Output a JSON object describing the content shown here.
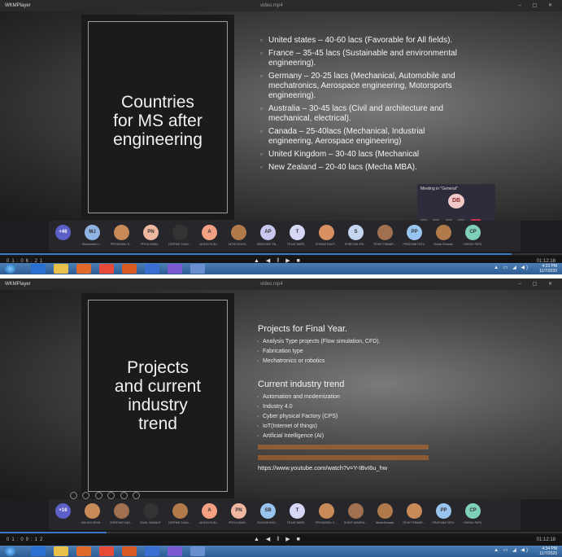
{
  "window": {
    "app_name": "WKMPlayer",
    "file_name": "video.mp4",
    "controls": "– ▢ ✕"
  },
  "slide1": {
    "title_lines": [
      "Countries",
      "for MS after",
      "engineering"
    ],
    "bullets": [
      "United states – 40-60 lacs (Favorable for All fields).",
      "France – 35-45 lacs (Sustainable and environmental engineering).",
      "Germany – 20-25 lacs (Mechanical, Automobile and mechatronics, Aerospace engineering, Motorsports engineering).",
      "Australia – 30-45 lacs (Civil and architecture and mechanical, electrical).",
      "Canada – 25-40lacs (Mechanical, Industrial engineering, Aerospace engineering)",
      "United Kingdom – 30-40 lacs (Mechanical",
      "New Zealand – 20-40 lacs (Mecha MBA)."
    ],
    "meeting_popup": {
      "title": "Meeting in \"General\"",
      "initials": "DB"
    }
  },
  "slide2": {
    "title_lines": [
      "Projects",
      "and current",
      "industry",
      "trend"
    ],
    "section1_heading": "Projects for Final Year.",
    "section1_items": [
      "Analysis Type projects (Flow simulation, CFD).",
      "Fabrication type",
      "Mechatronics or robotics"
    ],
    "section2_heading": "Current industry trend",
    "section2_items": [
      "Automation and modernization",
      "Industry 4.0",
      "Cyber physical Factory (CPS)",
      "IoT(Internet of things)",
      "Artificial Intelligence (AI)"
    ],
    "link_url": "https://www.youtube.com/watch?v=Y-IBvI6u_hw"
  },
  "participants1": [
    {
      "initials": "+46",
      "color": "#5b5fc7",
      "name": ""
    },
    {
      "initials": "MJ",
      "color": "#8fb4e3",
      "name": "Mohammed J..."
    },
    {
      "initials": "",
      "color": "#c98a5a",
      "name": "PRIYANSHU S..."
    },
    {
      "initials": "PN",
      "color": "#f0b8a0",
      "name": "PRIYA NAND..."
    },
    {
      "initials": "",
      "color": "#333",
      "name": "DEEPAK CHAU..."
    },
    {
      "initials": "A",
      "color": "#f4a082",
      "name": "AKASH KUM..."
    },
    {
      "initials": "",
      "color": "#b07a4a",
      "name": "NITIN SINGH..."
    },
    {
      "initials": "AP",
      "color": "#c7c7f0",
      "name": "ABHISHEK PA..."
    },
    {
      "initials": "T",
      "color": "#d6d6f5",
      "name": "TEJAS BARE..."
    },
    {
      "initials": "",
      "color": "#d99060",
      "name": "SHIVAM RAUT..."
    },
    {
      "initials": "S",
      "color": "#c6d6f0",
      "name": "SHREYAS SHI..."
    },
    {
      "initials": "",
      "color": "#a07050",
      "name": "ROHIT PAWAR..."
    },
    {
      "initials": "PP",
      "color": "#9ac4f0",
      "name": "PRATHAM PATIL"
    },
    {
      "initials": "",
      "color": "#b07a4a",
      "name": "Omkar Bhosale"
    },
    {
      "initials": "CP",
      "color": "#7fd0b8",
      "name": "CHIRAG PATIL"
    }
  ],
  "participants2": [
    {
      "initials": "+16",
      "color": "#5b5fc7",
      "name": ""
    },
    {
      "initials": "",
      "color": "#c98a5a",
      "name": "SAKSHI DESH..."
    },
    {
      "initials": "",
      "color": "#a07050",
      "name": "SHREYAS KAD..."
    },
    {
      "initials": "",
      "color": "#333",
      "name": "SAHIL SAWANT"
    },
    {
      "initials": "",
      "color": "#b07a4a",
      "name": "DEEPAK CHAU..."
    },
    {
      "initials": "A",
      "color": "#f4a082",
      "name": "AKASH KUM..."
    },
    {
      "initials": "PN",
      "color": "#f0b8a0",
      "name": "PRIYA NAND..."
    },
    {
      "initials": "SB",
      "color": "#9ac4f0",
      "name": "SUYASH BHO..."
    },
    {
      "initials": "T",
      "color": "#d6d6f5",
      "name": "TEJAS BARE..."
    },
    {
      "initials": "",
      "color": "#c98a5a",
      "name": "PRIYANSHU S..."
    },
    {
      "initials": "",
      "color": "#a07050",
      "name": "SUMIT MISHRA..."
    },
    {
      "initials": "",
      "color": "#b07a4a",
      "name": "Nikita Bhosale"
    },
    {
      "initials": "",
      "color": "#c98a5a",
      "name": "ROHIT PAWAR..."
    },
    {
      "initials": "PP",
      "color": "#9ac4f0",
      "name": "PRATHAM PATIL"
    },
    {
      "initials": "CP",
      "color": "#7fd0b8",
      "name": "CHIRAG PATIL"
    }
  ],
  "playback1": {
    "elapsed": "01:06:21",
    "total": "01:12:18",
    "progress": 0.91
  },
  "playback2": {
    "elapsed": "01:09:12",
    "total": "01:12:18",
    "progress": 0.19
  },
  "taskbar": {
    "clock1_time": "4:33 PM",
    "clock1_date": "11/7/2020",
    "clock2_time": "4:34 PM",
    "clock2_date": "11/7/2020"
  },
  "colors": {
    "accent": "#3a78c8",
    "hangup": "#c4314b",
    "link": "#e07a2a"
  }
}
